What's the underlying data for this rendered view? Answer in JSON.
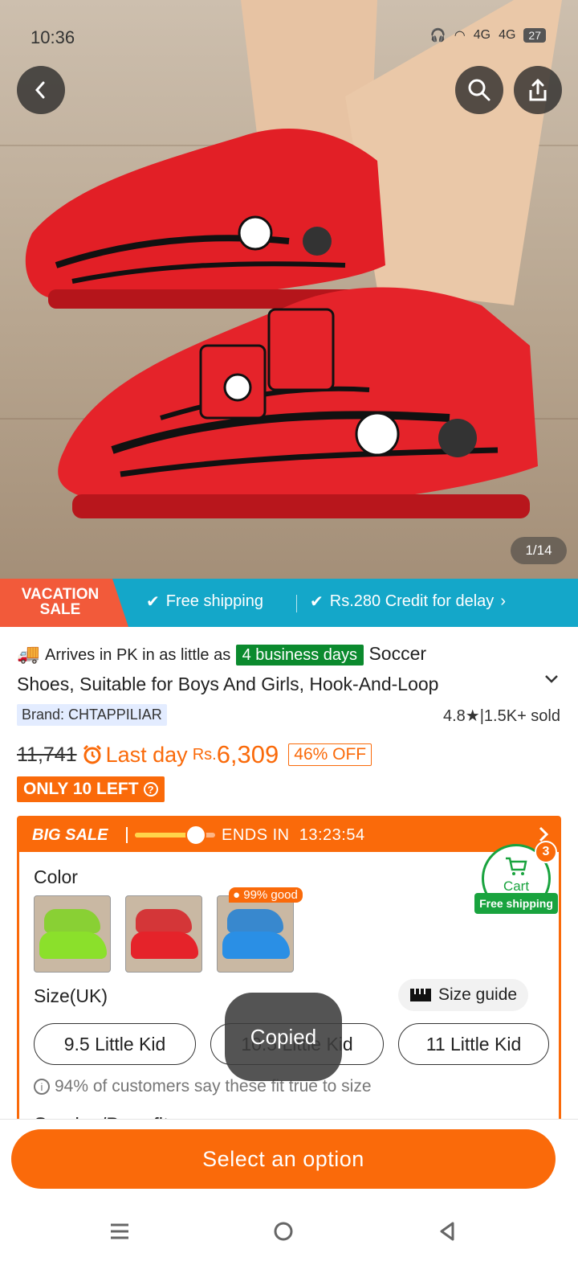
{
  "status_bar": {
    "time": "10:36",
    "network_1": "4G",
    "network_2": "4G",
    "battery": "27"
  },
  "gallery": {
    "counter": "1/14"
  },
  "promo_strip": {
    "badge_line1": "VACATION",
    "badge_line2": "SALE",
    "free_shipping": "Free shipping",
    "credit": "Rs.280 Credit for delay"
  },
  "product": {
    "arrives_text": "Arrives in PK in as little as",
    "days_badge": "4 business days",
    "title_part1": "Soccer",
    "title_part2": "Shoes, Suitable for Boys And Girls, Hook-And-Loop",
    "brand": "Brand: CHTAPPILIAR",
    "rating": "4.8",
    "sold": "1.5K+ sold",
    "old_price": "11,741",
    "last_day": "Last day",
    "currency": "Rs.",
    "price": "6,309",
    "discount": "46% OFF",
    "stock": "ONLY 10 LEFT"
  },
  "big_sale": {
    "label": "BIG SALE",
    "progress_fraction": 0.76,
    "ends_label": "ENDS IN",
    "countdown": "13:23:54"
  },
  "options": {
    "color_label": "Color",
    "colors": [
      "green",
      "red",
      "blue"
    ],
    "hot_badge": "99% good",
    "size_label": "Size(UK)",
    "size_guide": "Size guide",
    "sizes": [
      "9.5 Little Kid",
      "10.5 Little Kid",
      "11 Little Kid"
    ],
    "fit_note": "94% of customers say these fit true to size",
    "service_label": "Service/Benefits"
  },
  "cart": {
    "label": "Cart",
    "count": "3",
    "shipping": "Free shipping"
  },
  "toast": "Copied",
  "cta": "Select an option",
  "colors": {
    "accent": "#fa6a0a",
    "teal": "#14a7c9",
    "green": "#19a33e"
  }
}
